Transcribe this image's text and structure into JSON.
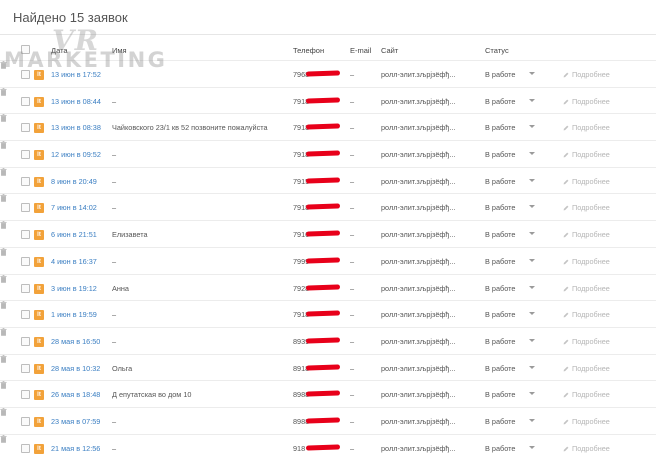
{
  "page": {
    "title": "Найдено 15 заявок"
  },
  "watermark": {
    "top": "VR",
    "bottom": "MARKETING"
  },
  "table": {
    "headers": {
      "date": "Дата",
      "name": "Имя",
      "phone": "Телефон",
      "email": "E-mail",
      "site": "Сайт",
      "status": "Статус"
    },
    "source_badge": "lt",
    "more_label": "Подробнее",
    "rows": [
      {
        "date": "13 июн в 17:52",
        "name": "",
        "phone": "7968",
        "email": "–",
        "site": "ролл-элит.зљрјзёфђ...",
        "status": "В работе"
      },
      {
        "date": "13 июн в 08:44",
        "name": "–",
        "phone": "7918",
        "email": "–",
        "site": "ролл-элит.зљрјзёфђ...",
        "status": "В работе"
      },
      {
        "date": "13 июн в 08:38",
        "name": "Чайковского 23/1 кв 52 позвоните пожалуйста",
        "phone": "7918",
        "email": "–",
        "site": "ролл-элит.зљрјзёфђ...",
        "status": "В работе"
      },
      {
        "date": "12 июн в 09:52",
        "name": "–",
        "phone": "7918",
        "email": "–",
        "site": "ролл-элит.зљрјзёфђ...",
        "status": "В работе"
      },
      {
        "date": "8 июн в 20:49",
        "name": "–",
        "phone": "7915",
        "email": "–",
        "site": "ролл-элит.зљрјзёфђ...",
        "status": "В работе"
      },
      {
        "date": "7 июн в 14:02",
        "name": "–",
        "phone": "7918",
        "email": "–",
        "site": "ролл-элит.зљрјзёфђ...",
        "status": "В работе"
      },
      {
        "date": "6 июн в 21:51",
        "name": "Елизавета",
        "phone": "7916",
        "email": "–",
        "site": "ролл-элит.зљрјзёфђ...",
        "status": "В работе"
      },
      {
        "date": "4 июн в 16:37",
        "name": "–",
        "phone": "7999",
        "email": "–",
        "site": "ролл-элит.зљрјзёфђ...",
        "status": "В работе"
      },
      {
        "date": "3 июн в 19:12",
        "name": "Анна",
        "phone": "7928",
        "email": "–",
        "site": "ролл-элит.зљрјзёфђ...",
        "status": "В работе"
      },
      {
        "date": "1 июн в 19:59",
        "name": "–",
        "phone": "7918",
        "email": "–",
        "site": "ролл-элит.зљрјзёфђ...",
        "status": "В работе"
      },
      {
        "date": "28 мая в 16:50",
        "name": "–",
        "phone": "8939",
        "email": "–",
        "site": "ролл-элит.зљрјзёфђ...",
        "status": "В работе"
      },
      {
        "date": "28 мая в 10:32",
        "name": "Ольга",
        "phone": "8918",
        "email": "–",
        "site": "ролл-элит.зљрјзёфђ...",
        "status": "В работе"
      },
      {
        "date": "26 мая в 18:48",
        "name": "Д епутатская во дом 10",
        "phone": "8988",
        "email": "–",
        "site": "ролл-элит.зљрјзёфђ...",
        "status": "В работе"
      },
      {
        "date": "23 мая в 07:59",
        "name": "–",
        "phone": "8988",
        "email": "–",
        "site": "ролл-элит.зљрјзёфђ...",
        "status": "В работе"
      },
      {
        "date": "21 мая в 12:56",
        "name": "–",
        "phone": "918",
        "email": "–",
        "site": "ролл-элит.зљрјзёфђ...",
        "status": "В работе"
      }
    ]
  },
  "colors": {
    "link": "#3a7ec2",
    "badge": "#f2a23a",
    "redaction": "#e8001a"
  }
}
